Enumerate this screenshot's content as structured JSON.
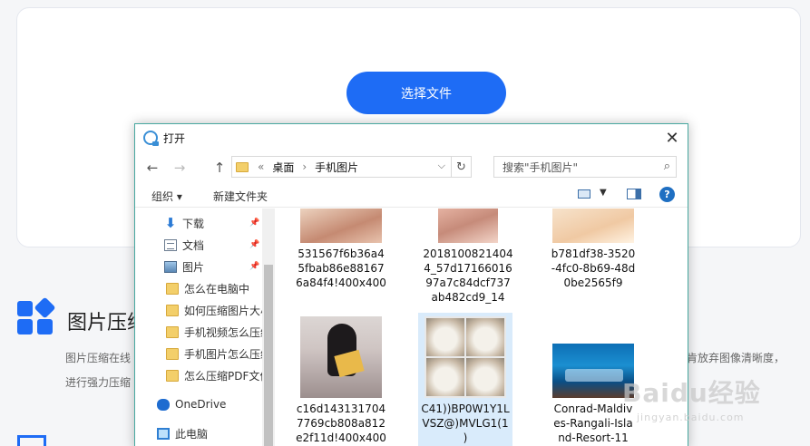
{
  "page": {
    "select_button": "选择文件",
    "feature_title": "图片压缩",
    "feature_desc_line1": "图片压缩在线",
    "feature_desc_line2": "进行强力压缩",
    "feature_desc_right": "肯放弃图像清晰度，",
    "watermark": "Baidu经验",
    "watermark_sub": "jingyan.baidu.com",
    "accent_color": "#1e6cf5"
  },
  "dialog": {
    "title": "打开",
    "close_icon": "close-icon",
    "nav": {
      "back": "←",
      "forward": "→",
      "up": "↑"
    },
    "address": {
      "prefix": "«",
      "segments": [
        "桌面",
        "手机图片"
      ],
      "separator": "›"
    },
    "search_placeholder": "搜索\"手机图片\"",
    "toolbar": {
      "organize": "组织 ▾",
      "new_folder": "新建文件夹",
      "help": "?"
    },
    "sidebar": [
      {
        "label": "下载",
        "icon": "download-icon",
        "pinned": true
      },
      {
        "label": "文档",
        "icon": "document-icon",
        "pinned": true
      },
      {
        "label": "图片",
        "icon": "pictures-icon",
        "pinned": true
      },
      {
        "label": "怎么在电脑中",
        "icon": "folder-icon"
      },
      {
        "label": "如何压缩图片大小",
        "icon": "folder-icon"
      },
      {
        "label": "手机视频怎么压缩",
        "icon": "folder-icon"
      },
      {
        "label": "手机图片怎么压缩",
        "icon": "folder-icon"
      },
      {
        "label": "怎么压缩PDF文件",
        "icon": "folder-icon"
      },
      {
        "label": "OneDrive",
        "icon": "onedrive-icon"
      },
      {
        "label": "此电脑",
        "icon": "computer-icon"
      }
    ],
    "files": [
      {
        "name": "531567f6b36a4\n5fbab86e88167\n6a84f4!400x400"
      },
      {
        "name": "2018100821404\n4_57d17166016\n97a7c84dcf737\nab482cd9_14"
      },
      {
        "name": "b781df38-3520\n-4fc0-8b69-48d\n0be2565f9"
      },
      {
        "name": "c16d143131704\n7769cb808a812\ne2f11d!400x400"
      },
      {
        "name": "C41))BP0W1Y1L\nVSZ@)MVLG1(1\n)"
      },
      {
        "name": "Conrad-Maldiv\nes-Rangali-Isla\nnd-Resort-11"
      }
    ]
  }
}
